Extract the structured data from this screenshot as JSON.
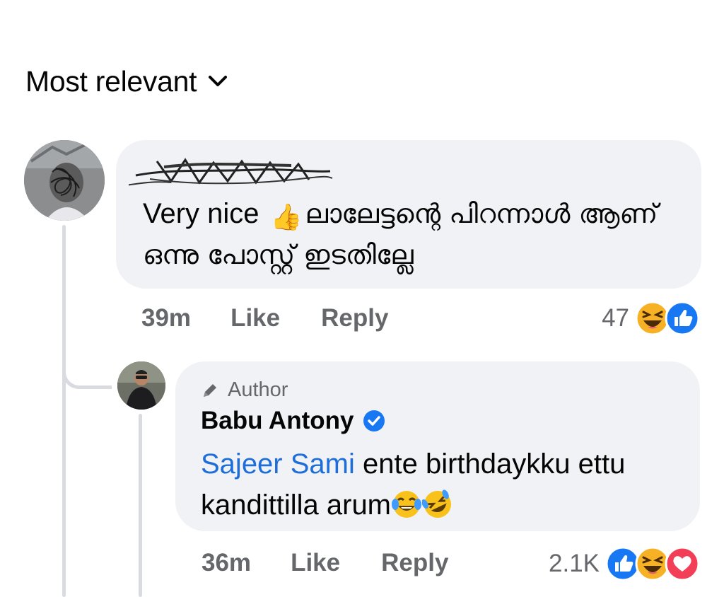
{
  "sort": {
    "label": "Most relevant",
    "icon": "chevron-down-icon"
  },
  "comments": [
    {
      "author": "Sajeer Sami",
      "author_obscured": true,
      "text_prefix": "Very nice",
      "emoji": "👍",
      "text_malayalam": "ലാലേട്ടന്റെ പിറന്നാൾ ആണ് ഒന്നു പോസ്റ്റ് ഇടതില്ലേ",
      "time": "39m",
      "like_label": "Like",
      "reply_label": "Reply",
      "reaction_count": "47",
      "reactions": [
        "haha",
        "like"
      ]
    }
  ],
  "reply": {
    "badge": "Author",
    "author": "Babu Antony",
    "verified": true,
    "mention": "Sajeer Sami",
    "text": " ente birthdaykku ettu kandittilla arum",
    "time": "36m",
    "like_label": "Like",
    "reply_label": "Reply",
    "reaction_count": "2.1K",
    "reactions": [
      "like",
      "haha",
      "love"
    ]
  },
  "colors": {
    "bubble": "#f0f2f5",
    "meta_text": "#65676b",
    "mention": "#1d6ed8",
    "like_blue": "#1877f2",
    "love_red": "#f33e58",
    "haha_yellow": "#f7b125"
  }
}
